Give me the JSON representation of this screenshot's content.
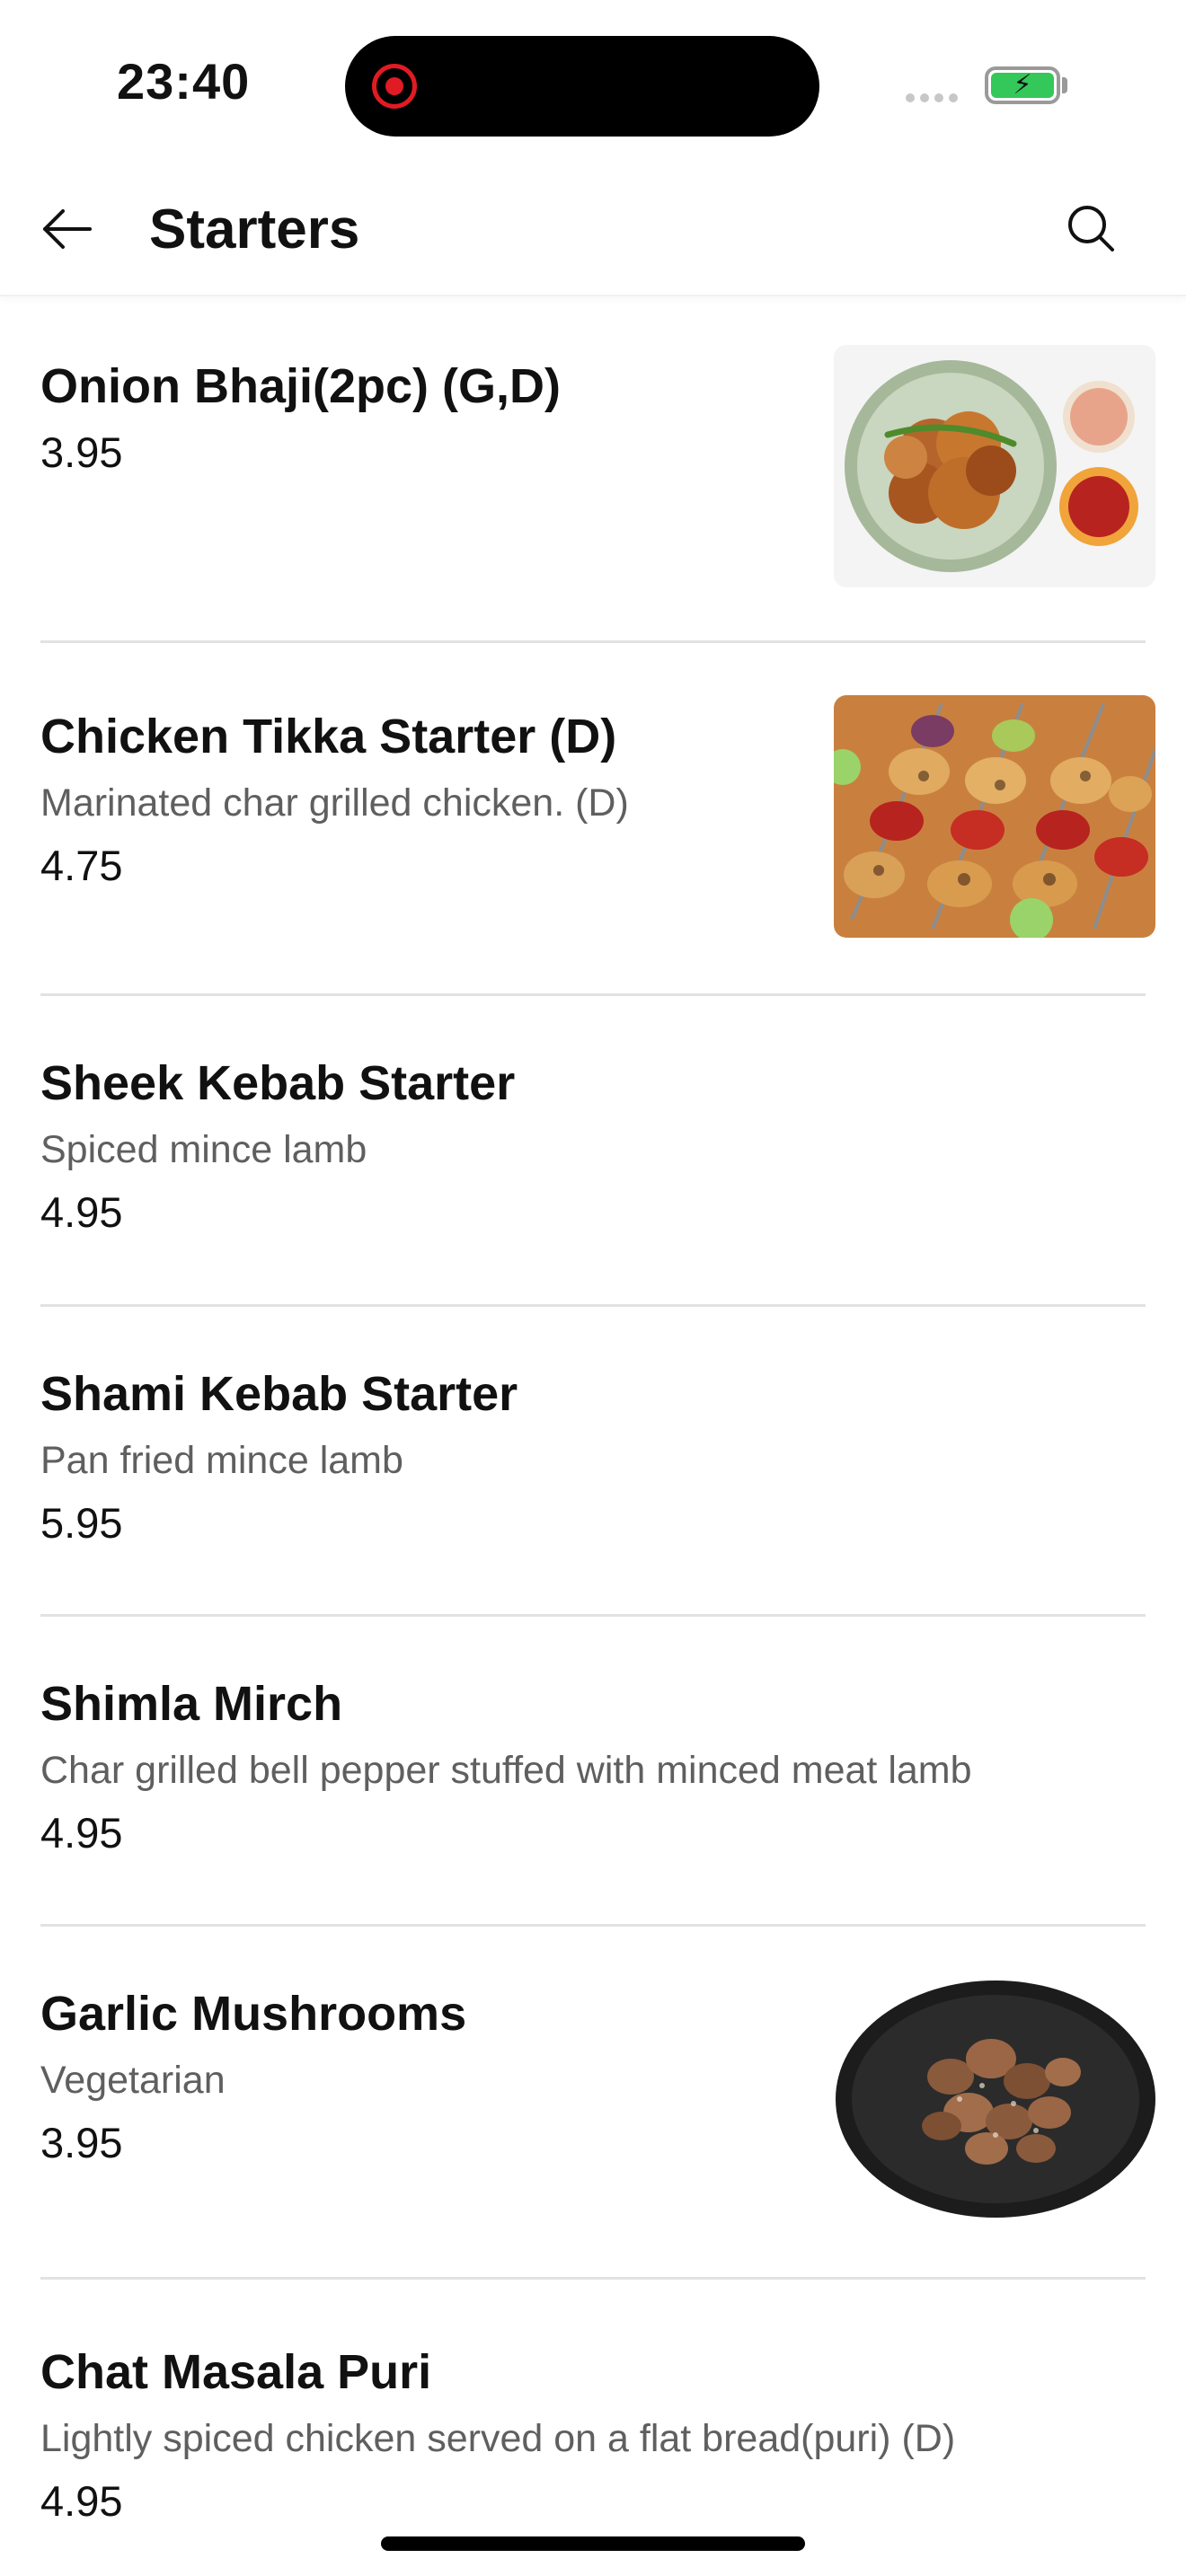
{
  "status_bar": {
    "time": "23:40",
    "recording_icon": "screen-record-icon",
    "signal_icon": "cellular-signal-icon",
    "battery_icon": "battery-charging-icon",
    "battery_color": "#34c759"
  },
  "header": {
    "back_icon": "arrow-left-icon",
    "title": "Starters",
    "search_icon": "search-icon"
  },
  "menu": {
    "items": [
      {
        "name": "Onion Bhaji(2pc) (G,D)",
        "description": "",
        "price": "3.95",
        "image": "onion-bhaji-photo"
      },
      {
        "name": "Chicken Tikka Starter (D)",
        "description": "Marinated char grilled chicken. (D)",
        "price": "4.75",
        "image": "chicken-tikka-photo"
      },
      {
        "name": "Sheek Kebab Starter",
        "description": "Spiced mince lamb",
        "price": "4.95",
        "image": ""
      },
      {
        "name": "Shami Kebab Starter",
        "description": "Pan fried mince lamb",
        "price": "5.95",
        "image": ""
      },
      {
        "name": "Shimla Mirch",
        "description": "Char grilled bell pepper stuffed with minced meat lamb",
        "price": "4.95",
        "image": ""
      },
      {
        "name": "Garlic Mushrooms",
        "description": "Vegetarian",
        "price": "3.95",
        "image": "garlic-mushrooms-photo"
      },
      {
        "name": "Chat Masala Puri",
        "description": "Lightly spiced chicken served on a flat bread(puri) (D)",
        "price": "4.95",
        "image": ""
      }
    ]
  }
}
